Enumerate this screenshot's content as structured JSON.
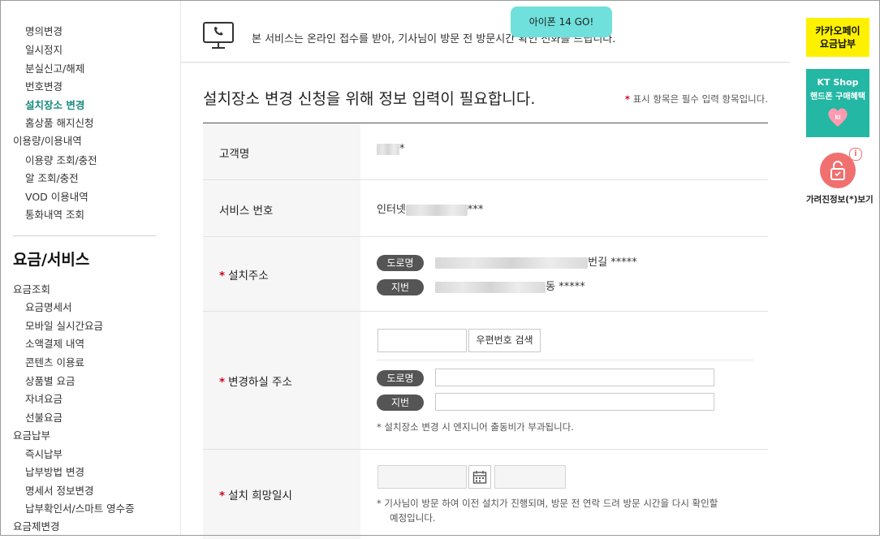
{
  "sidebar": {
    "items": [
      {
        "label": "명의변경"
      },
      {
        "label": "일시정지"
      },
      {
        "label": "분실신고/해제"
      },
      {
        "label": "번호변경"
      },
      {
        "label": "설치장소 변경"
      },
      {
        "label": "홈상품 해지신청"
      },
      {
        "label": "이용량/이용내역"
      },
      {
        "label": "이용량 조회/충전"
      },
      {
        "label": "알 조회/충전"
      },
      {
        "label": "VOD 이용내역"
      },
      {
        "label": "통화내역 조회"
      }
    ],
    "heading": "요금/서비스",
    "items2": [
      {
        "label": "요금조회"
      },
      {
        "label": "요금명세서"
      },
      {
        "label": "모바일 실시간요금"
      },
      {
        "label": "소액결제 내역"
      },
      {
        "label": "콘텐츠 이용료"
      },
      {
        "label": "상품별 요금"
      },
      {
        "label": "자녀요금"
      },
      {
        "label": "선불요금"
      },
      {
        "label": "요금납부"
      },
      {
        "label": "즉시납부"
      },
      {
        "label": "납부방법 변경"
      },
      {
        "label": "명세서 정보변경"
      },
      {
        "label": "납부확인서/스마트 영수증"
      },
      {
        "label": "요금제변경"
      }
    ]
  },
  "notice": {
    "text": "본 서비스는 온라인 접수를 받아, 기사님이 방문 전 방문시간 확인 전화를 드립니다."
  },
  "bubble": {
    "text": "아이폰 14 GO!"
  },
  "form": {
    "title": "설치장소 변경 신청을 위해 정보 입력이 필요합니다.",
    "required_star": "*",
    "required_note": "표시 항목은 필수 입력 항목입니다.",
    "rows": {
      "customer": {
        "label": "고객명",
        "value_suffix": "*"
      },
      "service": {
        "label": "서비스 번호",
        "value_prefix": "인터넷",
        "value_suffix": "***"
      },
      "address": {
        "label": "설치주소",
        "road_pill": "도로명",
        "road_suffix": "번길 *****",
        "jibun_pill": "지번",
        "jibun_suffix": "동 *****"
      },
      "new_address": {
        "label": "변경하실 주소",
        "zip_search_button": "우편번호 검색",
        "road_pill": "도로명",
        "jibun_pill": "지번",
        "note": "*  설치장소 변경 시 엔지니어 출동비가 부과됩니다."
      },
      "visit": {
        "label": "설치 희망일시",
        "note_line1": "*  기사님이 방문 하여 이전 설치가 진행되며, 방문 전 연락 드려 방문 시간을 다시 확인할",
        "note_line2": "예정입니다."
      }
    }
  },
  "rail": {
    "kakao_line1": "카카오페이",
    "kakao_line2": "요금납부",
    "ktshop_line1": "KT Shop",
    "ktshop_line2": "핸드폰 구매혜택",
    "ktshop_badge": "kt",
    "privacy_label": "가려진정보(*)보기",
    "privacy_info": "i"
  },
  "colors": {
    "accent": "#1a8a7e",
    "required": "#d0021b",
    "kakao": "#fef100",
    "ktshop": "#23b7a4",
    "bubble": "#6fe0dc",
    "pill": "#555555"
  },
  "icons": [
    "monitor-phone-icon",
    "calendar-icon",
    "heart-icon",
    "unlock-icon",
    "info-icon"
  ]
}
